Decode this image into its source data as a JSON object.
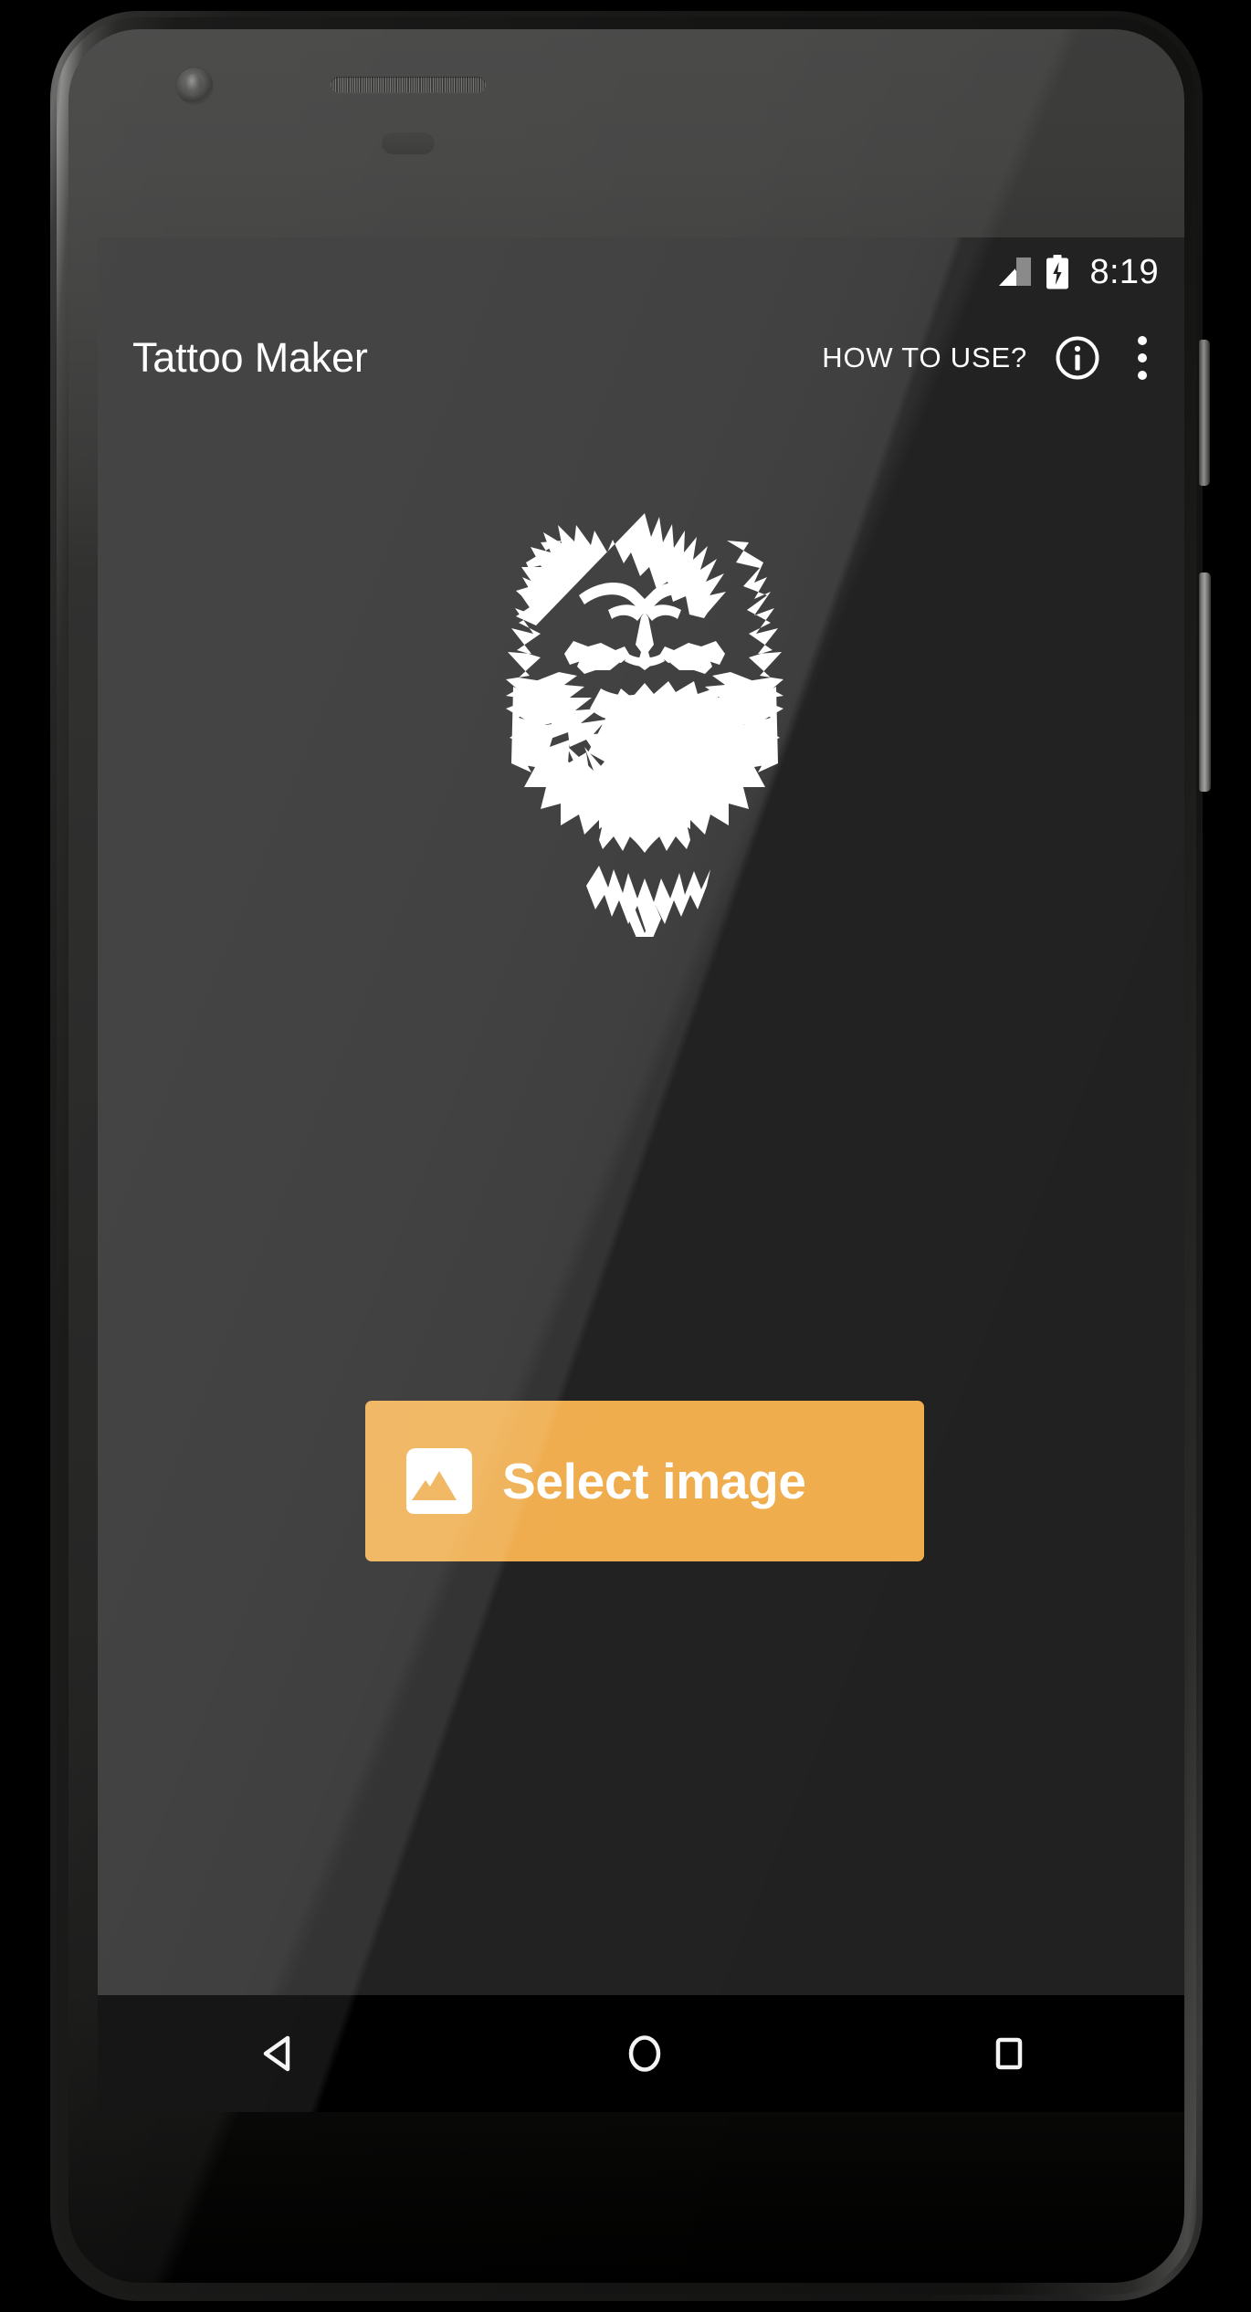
{
  "device": {
    "name": "android-phone-mockup",
    "camera": "front-camera",
    "speaker": "earpiece-speaker",
    "buttons": [
      "power-button",
      "volume-rocker"
    ]
  },
  "status_bar": {
    "signal_icon": "signal-bars-icon",
    "battery_icon": "battery-charging-icon",
    "time": "8:19"
  },
  "action_bar": {
    "title": "Tattoo Maker",
    "how_to_use_label": "HOW TO USE?",
    "info_icon": "info-circle-icon",
    "overflow_icon": "overflow-menu-icon"
  },
  "content": {
    "artwork_name": "lion-head-tattoo",
    "artwork_alt": "Tribal lion head tattoo artwork",
    "select_button": {
      "label": "Select image",
      "icon": "image-picture-icon"
    }
  },
  "nav_bar": {
    "back_label": "back-button",
    "home_label": "home-button",
    "recents_label": "recents-button"
  },
  "colors": {
    "accent_orange": "#efad4e",
    "screen_background": "#212121",
    "action_bar_background": "#212121",
    "nav_bar_background": "#000000",
    "text_primary": "#ffffff"
  }
}
